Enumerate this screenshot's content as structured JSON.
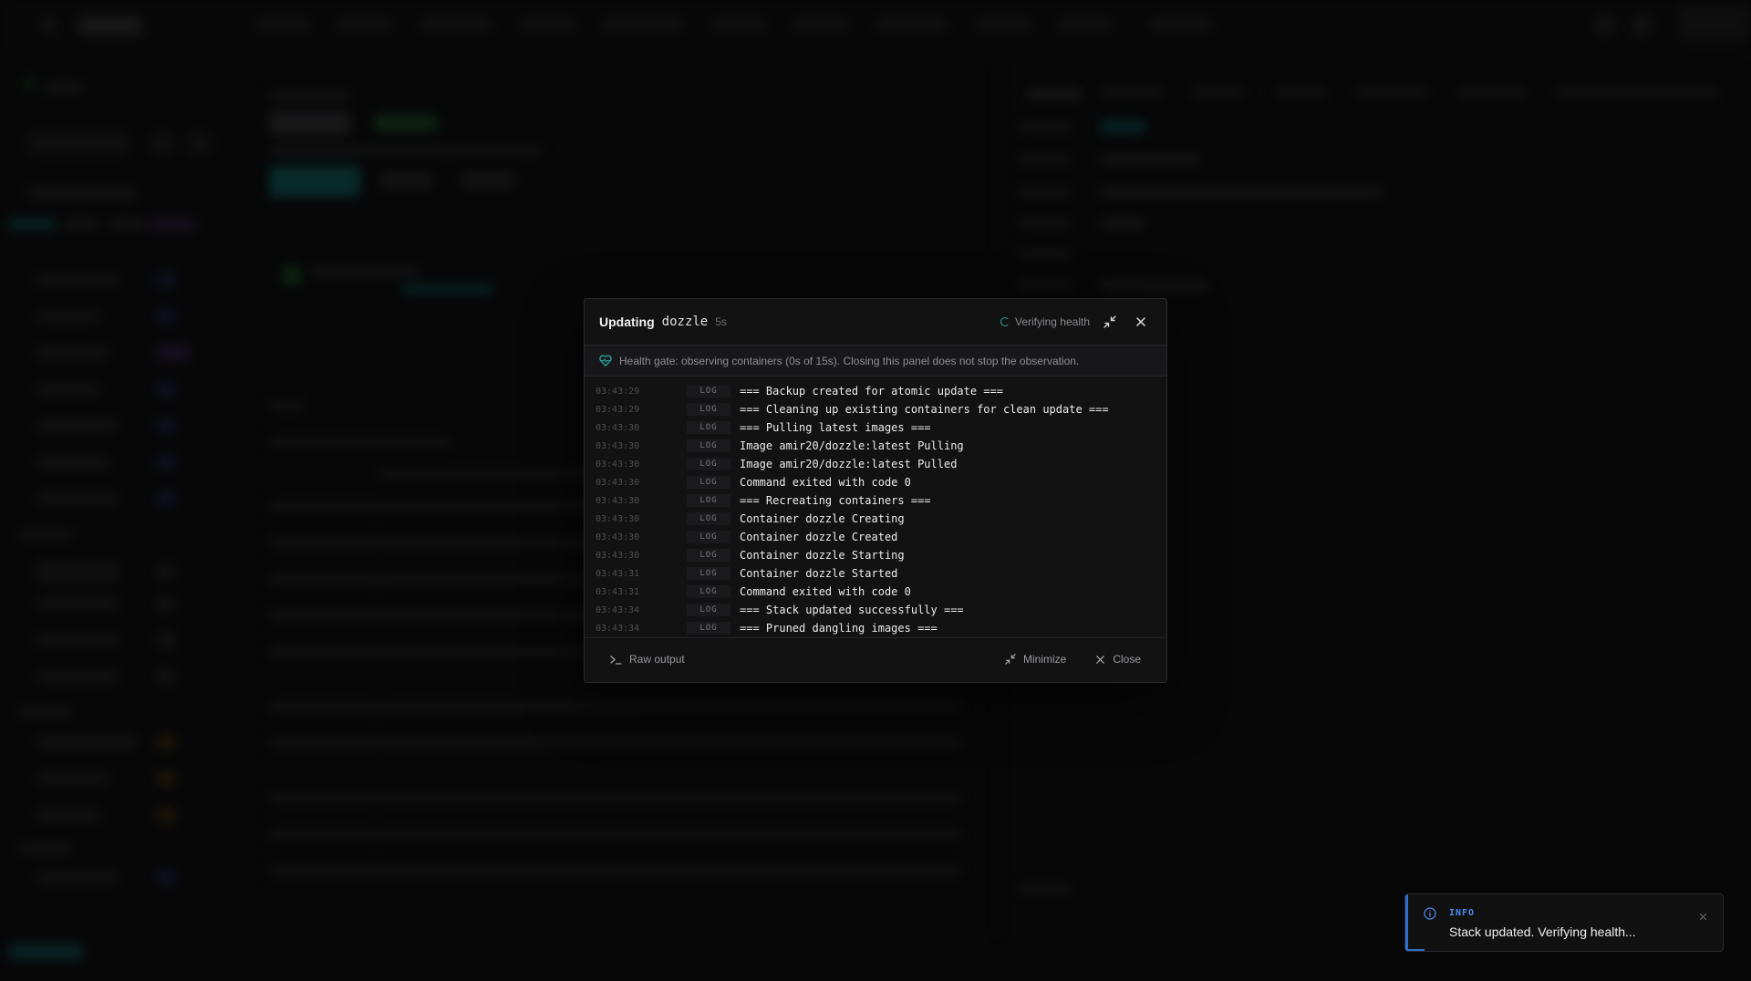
{
  "modal": {
    "title_prefix": "Updating",
    "stack_name": "dozzle",
    "elapsed": "5s",
    "status": "Verifying health",
    "health_gate": "Health gate: observing containers (0s of 15s). Closing this panel does not stop the observation.",
    "log": [
      {
        "time": "03:43:29",
        "level": "LOG",
        "message": "=== Backup created for atomic update ==="
      },
      {
        "time": "03:43:29",
        "level": "LOG",
        "message": "=== Cleaning up existing containers for clean update ==="
      },
      {
        "time": "03:43:30",
        "level": "LOG",
        "message": "=== Pulling latest images ==="
      },
      {
        "time": "03:43:30",
        "level": "LOG",
        "message": "Image amir20/dozzle:latest Pulling"
      },
      {
        "time": "03:43:30",
        "level": "LOG",
        "message": "Image amir20/dozzle:latest Pulled"
      },
      {
        "time": "03:43:30",
        "level": "LOG",
        "message": "Command exited with code 0"
      },
      {
        "time": "03:43:30",
        "level": "LOG",
        "message": "=== Recreating containers ==="
      },
      {
        "time": "03:43:30",
        "level": "LOG",
        "message": "Container dozzle Creating"
      },
      {
        "time": "03:43:30",
        "level": "LOG",
        "message": "Container dozzle Created"
      },
      {
        "time": "03:43:30",
        "level": "LOG",
        "message": "Container dozzle Starting"
      },
      {
        "time": "03:43:31",
        "level": "LOG",
        "message": "Container dozzle Started"
      },
      {
        "time": "03:43:31",
        "level": "LOG",
        "message": "Command exited with code 0"
      },
      {
        "time": "03:43:34",
        "level": "LOG",
        "message": "=== Stack updated successfully ==="
      },
      {
        "time": "03:43:34",
        "level": "LOG",
        "message": "=== Pruned dangling images ==="
      }
    ],
    "footer": {
      "raw_output": "Raw output",
      "minimize": "Minimize",
      "close": "Close"
    }
  },
  "toast": {
    "label": "INFO",
    "message": "Stack updated. Verifying health..."
  },
  "colors": {
    "accent_teal": "#2aa7a1",
    "info_blue": "#2e6fcf"
  },
  "icons": {
    "spinner": "loading-icon",
    "minimize": "minimize-icon",
    "close": "close-icon",
    "health": "heart-pulse-icon",
    "terminal": "terminal-icon",
    "info": "info-icon"
  }
}
